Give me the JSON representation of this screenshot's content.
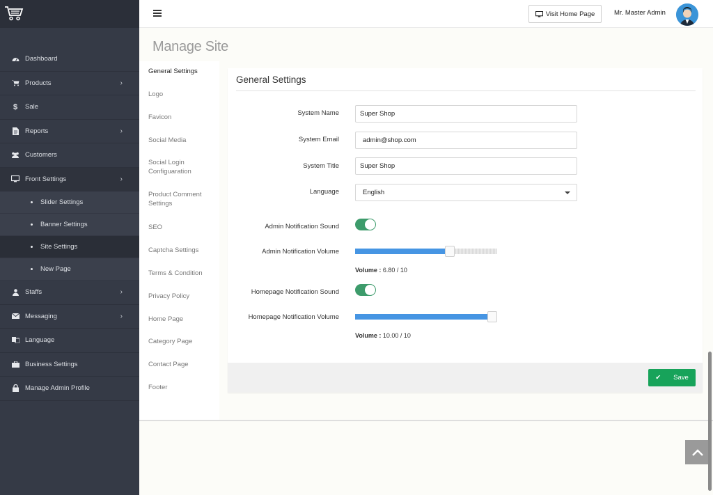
{
  "sidebar": {
    "items": [
      {
        "label": "Dashboard",
        "icon": "dashboard-icon",
        "has_chevron": false
      },
      {
        "label": "Products",
        "icon": "cart-icon",
        "has_chevron": true
      },
      {
        "label": "Sale",
        "icon": "dollar-icon",
        "has_chevron": false
      },
      {
        "label": "Reports",
        "icon": "report-icon",
        "has_chevron": true
      },
      {
        "label": "Customers",
        "icon": "users-icon",
        "has_chevron": false
      },
      {
        "label": "Front Settings",
        "icon": "desktop-icon",
        "has_chevron": true
      }
    ],
    "sub_items": [
      {
        "label": "Slider Settings"
      },
      {
        "label": "Banner Settings"
      },
      {
        "label": "Site Settings",
        "active": true
      },
      {
        "label": "New Page"
      }
    ],
    "items_after": [
      {
        "label": "Staffs",
        "icon": "user-icon",
        "has_chevron": true
      },
      {
        "label": "Messaging",
        "icon": "envelope-icon",
        "has_chevron": true
      },
      {
        "label": "Language",
        "icon": "language-icon",
        "has_chevron": false
      },
      {
        "label": "Business Settings",
        "icon": "briefcase-icon",
        "has_chevron": false
      },
      {
        "label": "Manage Admin Profile",
        "icon": "lock-icon",
        "has_chevron": false
      }
    ]
  },
  "topbar": {
    "visit_label": "Visit Home Page",
    "admin_name": "Mr. Master Admin"
  },
  "page": {
    "title": "Manage Site",
    "tabs": [
      "General Settings",
      "Logo",
      "Favicon",
      "Social Media",
      "Social Login Configuaration",
      "Product Comment Settings",
      "SEO",
      "Captcha Settings",
      "Terms & Condition",
      "Privacy Policy",
      "Home Page",
      "Category Page",
      "Contact Page",
      "Footer"
    ]
  },
  "form": {
    "panel_title": "General Settings",
    "system_name_label": "System Name",
    "system_name_value": "Super Shop",
    "system_email_label": "System Email",
    "system_email_value": "admin@shop.com",
    "system_title_label": "System Title",
    "system_title_value": "Super Shop",
    "language_label": "Language",
    "language_value": "English",
    "admin_sound_label": "Admin Notification Sound",
    "admin_sound_on": true,
    "admin_volume_label": "Admin Notification Volume",
    "admin_volume": 6.8,
    "admin_volume_text_prefix": "Volume :",
    "admin_volume_text": "6.80 / 10",
    "home_sound_label": "Homepage Notification Sound",
    "home_sound_on": true,
    "home_volume_label": "Homepage Notification Volume",
    "home_volume": 10,
    "home_volume_text_prefix": "Volume :",
    "home_volume_text": "10.00 / 10",
    "volume_max": 10,
    "save_label": "Save"
  },
  "colors": {
    "sidebar_bg": "#353a46",
    "accent_blue": "#4695e3",
    "toggle_green": "#3d9b6b",
    "save_green": "#17a35a"
  }
}
